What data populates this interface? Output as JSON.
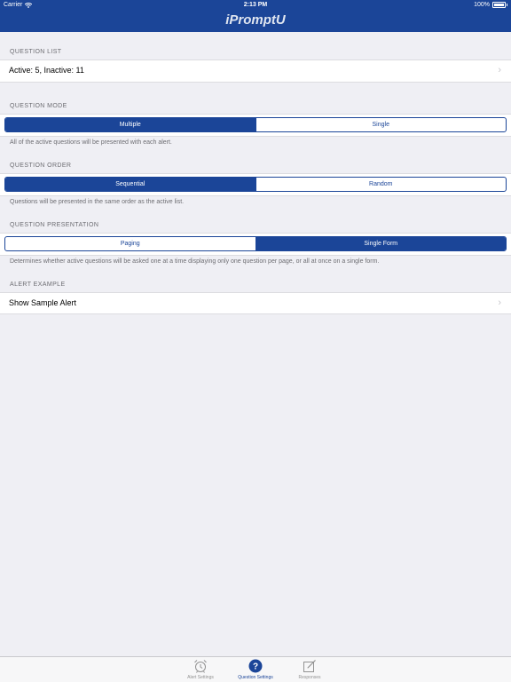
{
  "status_bar": {
    "carrier": "Carrier",
    "time": "2:13 PM",
    "battery": "100%"
  },
  "nav": {
    "title": "iPromptU"
  },
  "question_list": {
    "header": "QUESTION LIST",
    "value": "Active: 5, Inactive: 11"
  },
  "question_mode": {
    "header": "QUESTION MODE",
    "options": [
      "Multiple",
      "Single"
    ],
    "selected": "Multiple",
    "footnote": "All of the active questions will be presented with each alert."
  },
  "question_order": {
    "header": "QUESTION ORDER",
    "options": [
      "Sequential",
      "Random"
    ],
    "selected": "Sequential",
    "footnote": "Questions will be presented in the same order as the active list."
  },
  "question_presentation": {
    "header": "QUESTION PRESENTATION",
    "options": [
      "Paging",
      "Single Form"
    ],
    "selected": "Single Form",
    "footnote": "Determines whether active questions will be asked one at a time displaying only one question per page, or all at once on a single form."
  },
  "alert_example": {
    "header": "ALERT EXAMPLE",
    "label": "Show Sample Alert"
  },
  "tabs": [
    {
      "label": "Alert Settings",
      "icon": "alarm-clock-icon",
      "active": false
    },
    {
      "label": "Question Settings",
      "icon": "question-icon",
      "active": true
    },
    {
      "label": "Responses",
      "icon": "compose-icon",
      "active": false
    }
  ],
  "colors": {
    "brand": "#1b4598",
    "background": "#efeff4",
    "chevron": "#c7c7cc",
    "tab_inactive": "#929292"
  }
}
